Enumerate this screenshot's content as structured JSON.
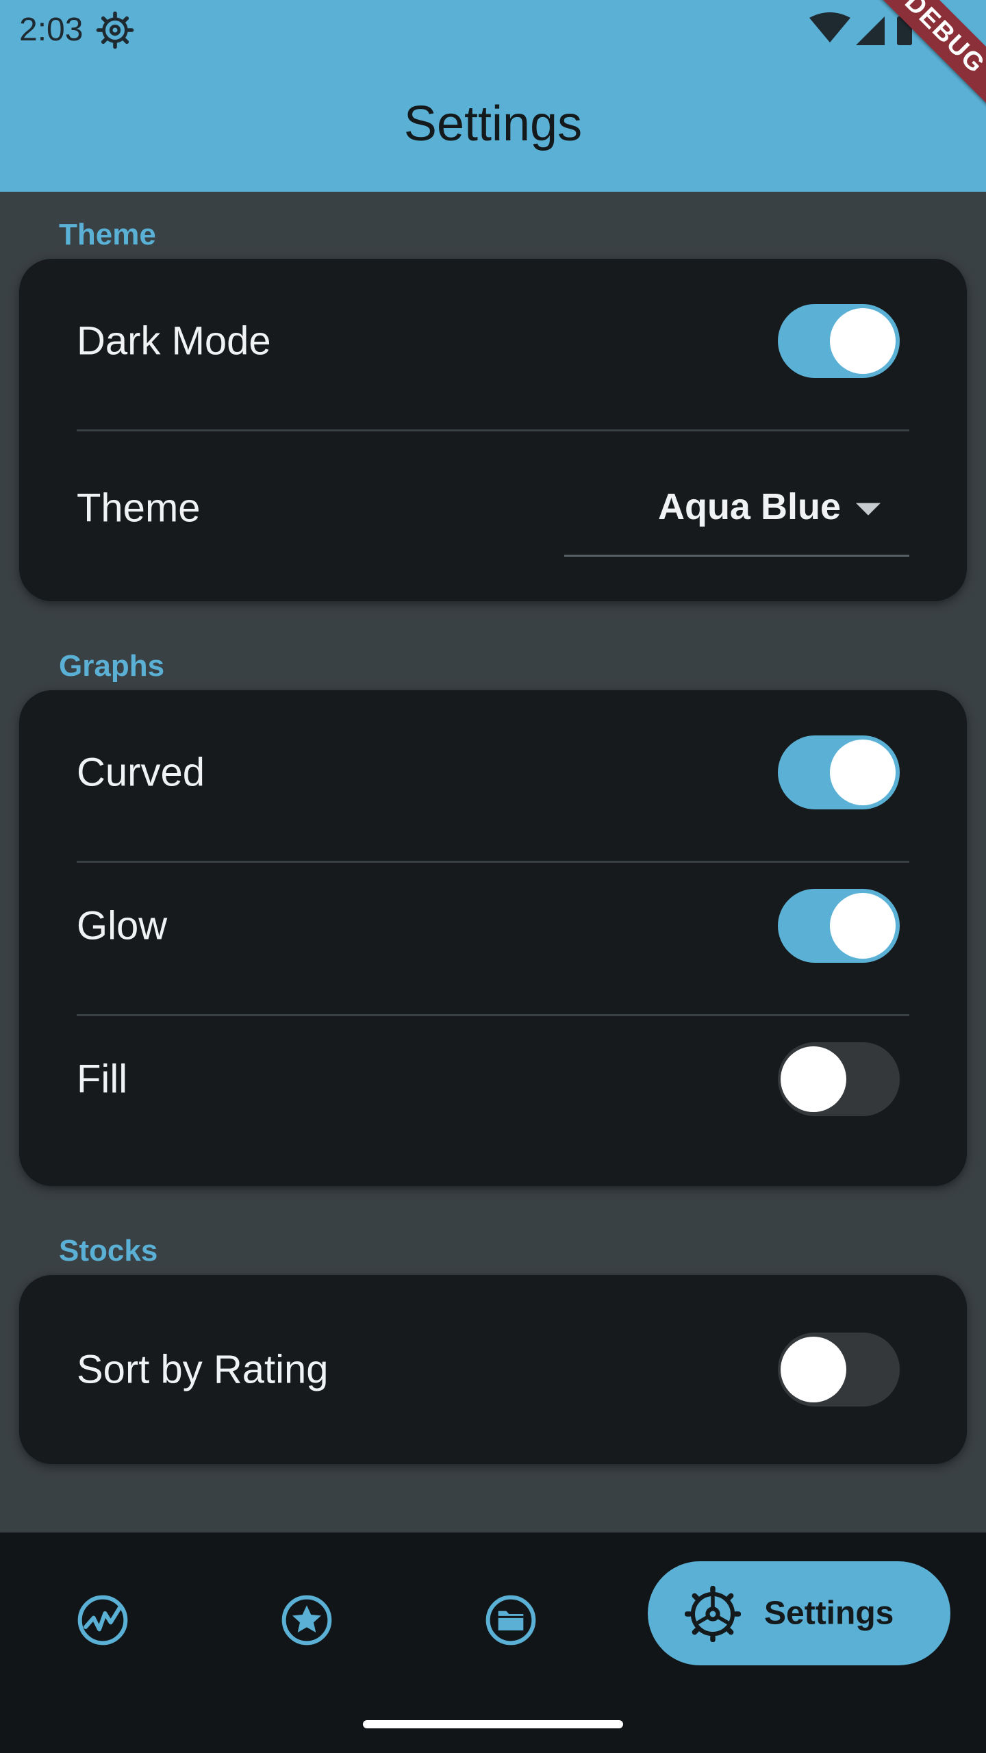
{
  "status_bar": {
    "time": "2:03",
    "icons": [
      "settings-gear-icon",
      "wifi-icon",
      "signal-icon",
      "battery-icon"
    ]
  },
  "debug_banner": "DEBUG",
  "app_bar": {
    "title": "Settings"
  },
  "colors": {
    "accent": "#5ab0d5",
    "background": "#3a4145",
    "card": "#161a1c",
    "nav_background": "#121517",
    "debug_ribbon": "#8b3038"
  },
  "sections": {
    "theme": {
      "title": "Theme",
      "dark_mode": {
        "label": "Dark Mode",
        "enabled": true
      },
      "theme_select": {
        "label": "Theme",
        "value": "Aqua Blue"
      }
    },
    "graphs": {
      "title": "Graphs",
      "curved": {
        "label": "Curved",
        "enabled": true
      },
      "glow": {
        "label": "Glow",
        "enabled": true
      },
      "fill": {
        "label": "Fill",
        "enabled": false
      }
    },
    "stocks": {
      "title": "Stocks",
      "sort_by_rating": {
        "label": "Sort by Rating",
        "enabled": false
      }
    }
  },
  "bottom_nav": {
    "items": [
      {
        "icon": "chart-icon"
      },
      {
        "icon": "star-icon"
      },
      {
        "icon": "folder-icon"
      },
      {
        "icon": "settings-gear-icon",
        "label": "Settings",
        "selected": true
      }
    ]
  }
}
